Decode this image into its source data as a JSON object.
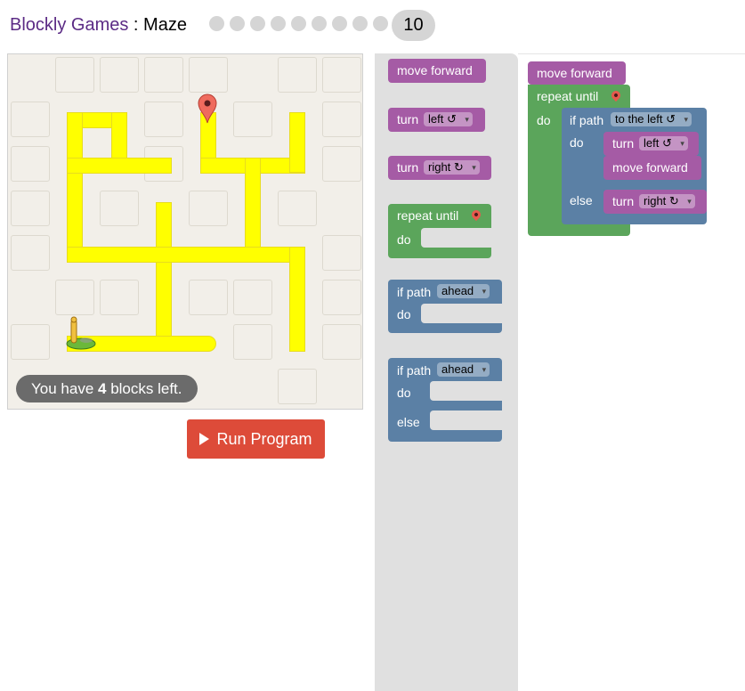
{
  "header": {
    "brand": "Blockly Games",
    "separator": " : ",
    "game": "Maze",
    "levels_done": 9,
    "current_level": "10"
  },
  "maze": {
    "message_prefix": "You have ",
    "blocks_left": "4",
    "message_suffix": " blocks left."
  },
  "run_button": {
    "label": "Run Program"
  },
  "toolbox": {
    "move_forward": "move forward",
    "turn": "turn",
    "left": "left ↺",
    "right": "right ↻",
    "repeat_until": "repeat until",
    "do": "do",
    "if_path": "if path",
    "ahead": "ahead",
    "else": "else"
  },
  "workspace": {
    "move_forward_1": "move forward",
    "repeat_until": "repeat until",
    "do": "do",
    "if_path": "if path",
    "to_the_left": "to the left ↺",
    "if_do": "do",
    "turn_1": "turn",
    "left": "left ↺",
    "move_forward_2": "move forward",
    "else": "else",
    "turn_2": "turn",
    "right": "right ↻"
  },
  "colors": {
    "motion": "#a55ba5",
    "loop": "#5ba55b",
    "logic": "#5b80a5",
    "run": "#dd4b39",
    "path": "#ffff00"
  }
}
